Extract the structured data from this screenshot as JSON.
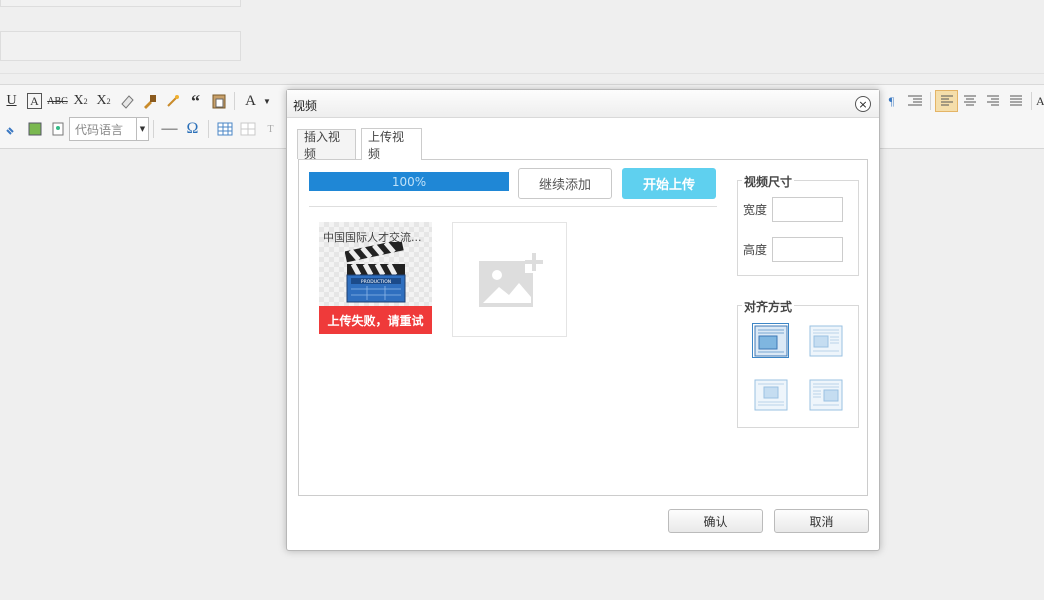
{
  "toolbar": {
    "code_language_placeholder": "代码语言"
  },
  "dialog": {
    "title": "视频",
    "close_symbol": "×",
    "tabs": [
      {
        "label": "插入视频",
        "active": false
      },
      {
        "label": "上传视频",
        "active": true
      }
    ],
    "progress": {
      "text": "100%",
      "value": 1.0
    },
    "add_more_label": "继续添加",
    "start_upload_label": "开始上传",
    "file": {
      "name": "中国国际人才交流...",
      "status": "上传失败，请重试",
      "clapper_text": "PRODUCTION"
    },
    "size_section": {
      "legend": "视频尺寸",
      "width_label": "宽度",
      "height_label": "高度",
      "width_value": "",
      "height_value": ""
    },
    "align_section": {
      "legend": "对齐方式",
      "options": [
        {
          "name": "align-none",
          "selected": true
        },
        {
          "name": "align-left",
          "selected": false
        },
        {
          "name": "align-center",
          "selected": false
        },
        {
          "name": "align-right",
          "selected": false
        }
      ]
    },
    "ok_label": "确认",
    "cancel_label": "取消"
  },
  "colors": {
    "progress": "#1f87d6",
    "upload_button": "#5fd0ef",
    "error": "#ef3a3a",
    "selection": "#3d86c6"
  }
}
